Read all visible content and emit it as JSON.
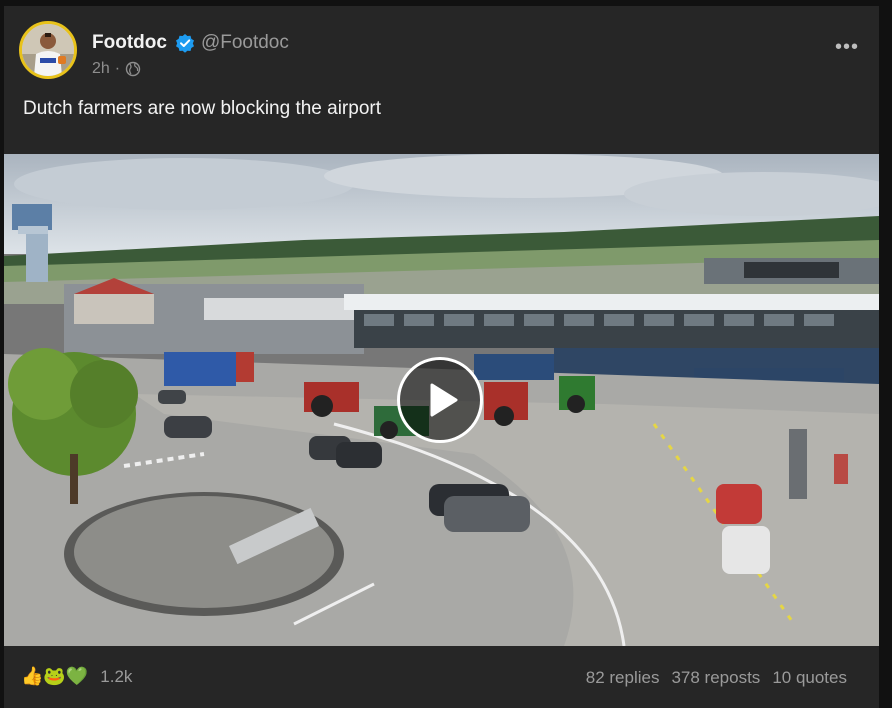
{
  "post": {
    "display_name": "Footdoc",
    "handle": "@Footdoc",
    "time": "2h",
    "visibility_icon": "globe-icon",
    "verified_icon": "verified-badge-icon",
    "more_label": "•••",
    "text": "Dutch farmers are now blocking the airport"
  },
  "media": {
    "type": "video",
    "play_icon": "play-icon"
  },
  "footer": {
    "reaction_emojis": [
      "👍",
      "🐸",
      "💚"
    ],
    "reaction_count": "1.2k",
    "replies": "82 replies",
    "reposts": "378 reposts",
    "quotes": "10 quotes"
  },
  "colors": {
    "background": "#111111",
    "card": "#262626",
    "verified": "#1d9bf0",
    "avatar_ring": "#e8c21a"
  }
}
